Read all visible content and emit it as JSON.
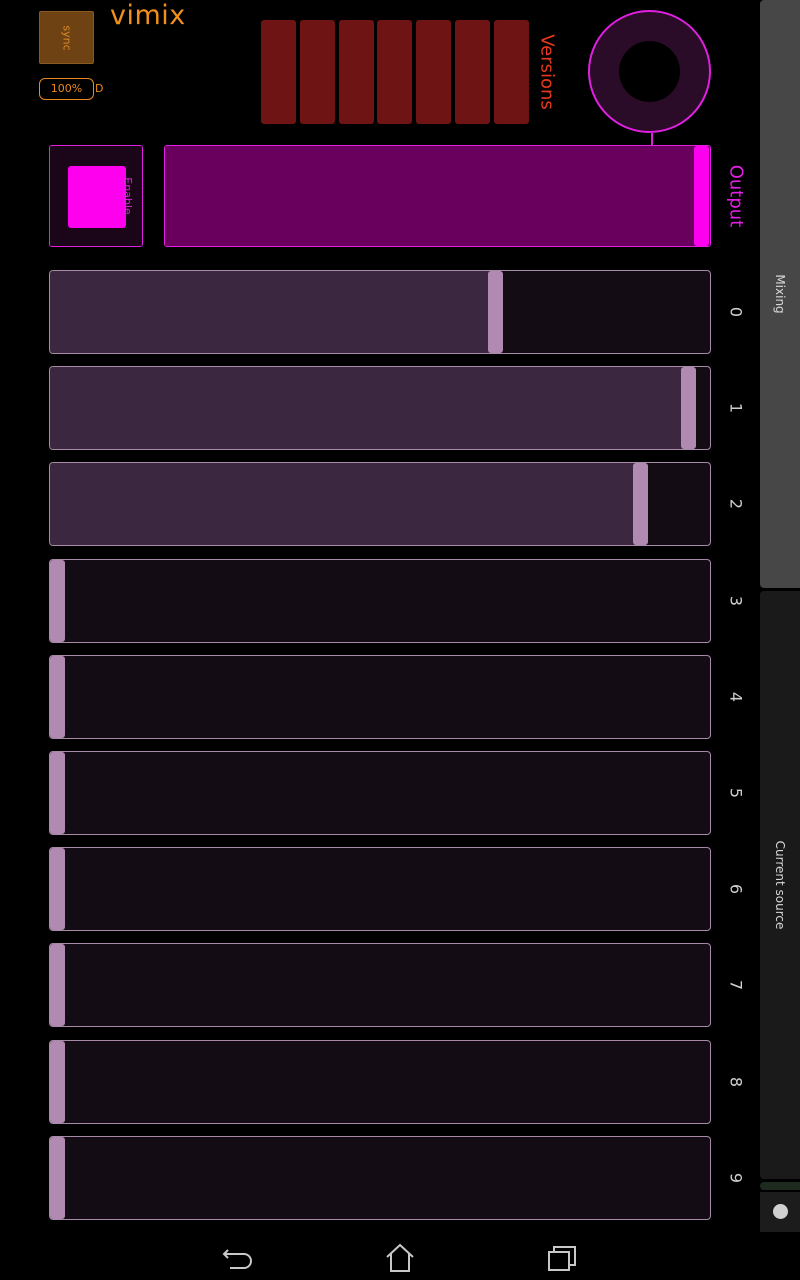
{
  "app": {
    "title": "vimix"
  },
  "controls": {
    "sync_label": "sync",
    "zoom_label": "100%",
    "zoom_suffix": "D",
    "versions_label": "Versions",
    "versions_count": 7,
    "enable_label": "Enable",
    "output_label": "Output",
    "output_level": 1.0
  },
  "mixing": {
    "channels": [
      {
        "index": "0",
        "level": 0.68
      },
      {
        "index": "1",
        "level": 0.98
      },
      {
        "index": "2",
        "level": 0.905
      },
      {
        "index": "3",
        "level": 0.0
      },
      {
        "index": "4",
        "level": 0.0
      },
      {
        "index": "5",
        "level": 0.0
      },
      {
        "index": "6",
        "level": 0.0
      },
      {
        "index": "7",
        "level": 0.0
      },
      {
        "index": "8",
        "level": 0.0
      },
      {
        "index": "9",
        "level": 0.0
      }
    ]
  },
  "side_tabs": {
    "mixing": "Mixing",
    "current_source": "Current source"
  },
  "colors": {
    "accent": "#e020e0",
    "title": "#f0901c",
    "versions": "#6e1414",
    "versions_text": "#e8391c",
    "slider_border": "#a68aa8",
    "slider_handle": "#b08ab0"
  },
  "icons": {
    "back": "back-arrow-icon",
    "home": "home-icon",
    "recent": "recent-apps-icon"
  }
}
